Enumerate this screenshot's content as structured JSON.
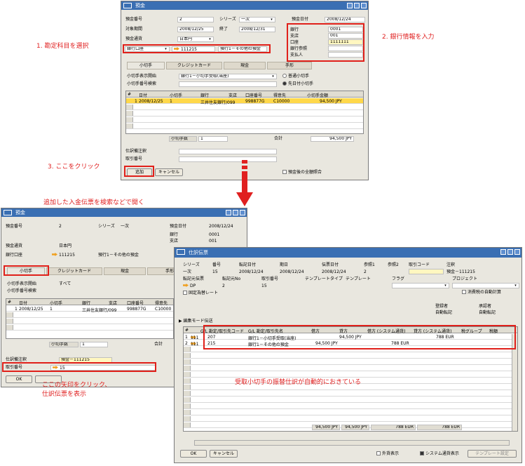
{
  "annotations": {
    "step1": "1. 勘定科目を選択",
    "step2": "2. 銀行情報を入力",
    "step3": "3. ここをクリック",
    "open_note": "追加した入金伝票を検索などで開く",
    "arrow_note": "ここの矢印をクリック、\n仕訳伝票を表示",
    "auto_note": "受取小切手の振替仕訳が自動的におきている"
  },
  "deposit1": {
    "title": "預金",
    "deposit_no_label": "預金番号",
    "deposit_no": "2",
    "series_label": "シリーズ",
    "series": "一次",
    "date_label": "預金日付",
    "date": "2008/12/24",
    "period_label": "対象期間",
    "period_from": "2008/12/25",
    "to_label": "終了",
    "period_to": "2008/12/31",
    "currency_label": "預金通貨",
    "currency": "日本円",
    "account_select": "銀行口座",
    "account_code": "111215",
    "account_name": "預行1－その他の預金",
    "bank_label": "銀行",
    "bank": "0001",
    "branch_label": "支店",
    "branch": "001",
    "acct_label": "口座",
    "acct": "1111111",
    "bank_ref_label": "銀行参照",
    "payer_label": "支払人",
    "tabs": [
      "小切手",
      "クレジットカード",
      "現金",
      "手形"
    ],
    "check_bank_label": "小切手表示開始",
    "check_bank": "銀行1－小切手受取(当座)",
    "check_no_search_label": "小切手番号検索",
    "radio1": "普通小切手",
    "radio2": "先日付小切手",
    "headers": [
      "#",
      "日付",
      "小切手",
      "銀行",
      "支店",
      "口座番号",
      "得意先",
      "小切手金額"
    ],
    "row": [
      "1",
      "2008/12/25",
      "1",
      "三井住友銀行/099",
      "998877G",
      "C10000",
      "94,500 JPY"
    ],
    "checks_label": "小切手数",
    "checks": "1",
    "total_label": "合計",
    "total": "94,500 JPY",
    "journal_note_label": "仕訳備注釈",
    "trans_no_label": "取引番号",
    "add": "追加",
    "cancel": "キャンセル",
    "keep_label": "預金後の全額照合"
  },
  "deposit2": {
    "title": "預金",
    "deposit_no_label": "預金番号",
    "deposit_no": "2",
    "series_label": "シリーズ",
    "series": "一次",
    "date_label": "預金日付",
    "date": "2008/12/24",
    "bank_label": "銀行",
    "bank": "0001",
    "branch_label": "支店",
    "branch": "001",
    "currency_label": "預金通貨",
    "currency": "日本円",
    "account_label": "銀行口座",
    "account_code": "111215",
    "account_name": "預行1－その他の預金",
    "tabs": [
      "小切手",
      "クレジットカード",
      "現金",
      "手形"
    ],
    "check_bank_label": "小切手表示開始",
    "check_bank": "すべて",
    "check_no_search_label": "小切手番号検索",
    "headers": [
      "#",
      "日付",
      "小切手",
      "銀行",
      "支店",
      "口座番号",
      "得意先"
    ],
    "row": [
      "1",
      "2008/12/25",
      "1",
      "三井住友銀行/099",
      "998877G",
      "C10000"
    ],
    "checks_label": "小切手数",
    "checks": "1",
    "total_label": "合計",
    "journal_note_label": "仕訳備注釈",
    "journal_note": "預金－111215",
    "trans_no_label": "取引番号",
    "trans_no": "15",
    "ok": "OK"
  },
  "journal": {
    "title": "仕訳伝票",
    "series_label": "シリーズ",
    "series": "一次",
    "no_label": "番号",
    "no": "15",
    "post_label": "転記日付",
    "post": "2008/12/24",
    "due_label": "期日",
    "due": "2008/12/24",
    "doc_label": "伝票日付",
    "doc": "2008/12/24",
    "ref1_label": "参照1",
    "ref1": "2",
    "ref2_label": "参照2",
    "trans_code_label": "取引コード",
    "memo_label": "注釈",
    "memo": "預金－111215",
    "origin_label": "転記元伝票",
    "origin": "DP",
    "origin_no_label": "転記元No",
    "origin_no": "2",
    "trans_no_label": "取引番号",
    "trans_no": "15",
    "template_type_label": "テンプレートタイプ",
    "template_label": "テンプレート",
    "flag_label": "フラグ",
    "project_label": "プロジェクト",
    "fixed_rate_label": "固定為替レート",
    "auto_reverse_label": "消費税の自動計算",
    "creator_label": "登録者",
    "creator": "自動転記",
    "approver_label": "承認者",
    "approver": "自動転記",
    "edit_label": "編集モード伝送",
    "headers": [
      "#",
      "G/L 勘定/取引先コード",
      "G/L 勘定/取引先名",
      "借方",
      "貸方",
      "借方 (システム通貨)",
      "貸方 (システム通貨)",
      "税グループ",
      "税額"
    ],
    "rows": [
      [
        "1",
        "111",
        "207",
        "銀行1－小切手受取(当座)",
        "",
        "94,500 JPY",
        "",
        "788 EUR"
      ],
      [
        "2",
        "111",
        "215",
        "銀行1－その他の預金",
        "94,500 JPY",
        "",
        "788 EUR",
        ""
      ]
    ],
    "totals": [
      "94,500 JPY",
      "94,500 JPY",
      "788 EUR",
      "788 EUR"
    ],
    "ok": "OK",
    "cancel": "キャンセル",
    "fc_label": "外貨表示",
    "sys_label": "システム通貨表示",
    "tpl_btn": "テンプレート設定"
  }
}
